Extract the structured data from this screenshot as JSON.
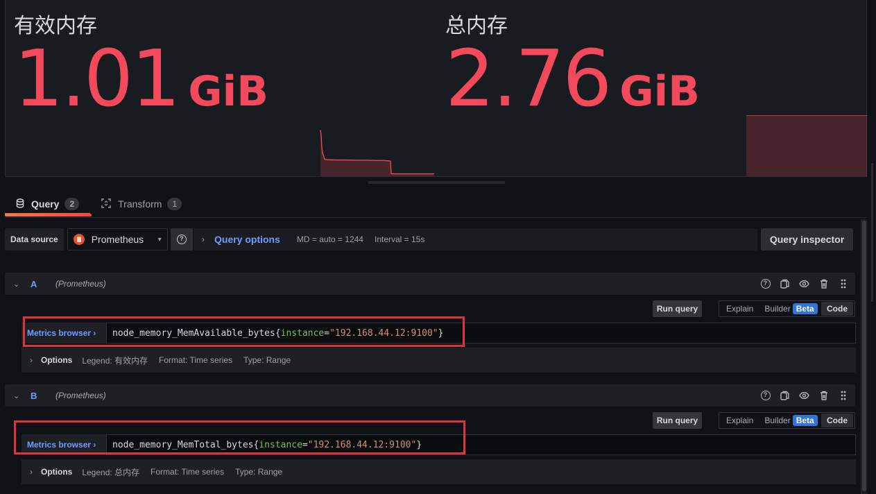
{
  "panels": [
    {
      "title": "有效内存",
      "value": "1.01",
      "unit": "GiB",
      "color": "#f2495c",
      "sparkline": [
        1.9,
        1.7,
        1.2,
        0.95,
        0.9,
        0.7,
        0.68,
        0.67,
        0.67,
        0.66,
        0.66,
        0.65,
        0.65,
        0.64,
        0.64,
        0.63,
        0.63,
        0.62,
        0.1,
        0.1,
        0.1,
        0.1,
        0.1,
        0.1,
        0.1
      ]
    },
    {
      "title": "总内存",
      "value": "2.76",
      "unit": "GiB",
      "color": "#f2495c",
      "sparkline": [
        1,
        1,
        1,
        1,
        1
      ]
    }
  ],
  "tabs": [
    {
      "label": "Query",
      "count": "2",
      "icon": "database-icon",
      "active": true
    },
    {
      "label": "Transform",
      "count": "1",
      "icon": "transform-icon",
      "active": false
    }
  ],
  "datasource": {
    "label": "Data source",
    "selected": "Prometheus",
    "help_icon": "question-circle-icon"
  },
  "query_options": {
    "title": "Query options",
    "md": "MD = auto = 1244",
    "interval": "Interval = 15s"
  },
  "query_inspector": "Query inspector",
  "queries": [
    {
      "ref": "A",
      "datasource": "(Prometheus)",
      "run_label": "Run query",
      "modes": {
        "explain": "Explain",
        "builder": "Builder",
        "beta": "Beta",
        "code": "Code"
      },
      "metrics_browser": "Metrics browser",
      "expr_metric": "node_memory_MemAvailable_bytes",
      "expr_open": "{",
      "expr_label": "instance",
      "expr_eq": "=",
      "expr_value": "\"192.168.44.12:9100\"",
      "expr_close": "}",
      "options_title": "Options",
      "legend": "Legend: 有效内存",
      "format": "Format: Time series",
      "type": "Type: Range"
    },
    {
      "ref": "B",
      "datasource": "(Prometheus)",
      "run_label": "Run query",
      "modes": {
        "explain": "Explain",
        "builder": "Builder",
        "beta": "Beta",
        "code": "Code"
      },
      "metrics_browser": "Metrics browser",
      "expr_metric": "node_memory_MemTotal_bytes",
      "expr_open": "{",
      "expr_label": "instance",
      "expr_eq": "=",
      "expr_value": "\"192.168.44.12:9100\"",
      "expr_close": "}",
      "options_title": "Options",
      "legend": "Legend: 总内存",
      "format": "Format: Time series",
      "type": "Type: Range"
    }
  ],
  "icons": {
    "chevron_right": "›",
    "chevron_down": "⌄"
  }
}
